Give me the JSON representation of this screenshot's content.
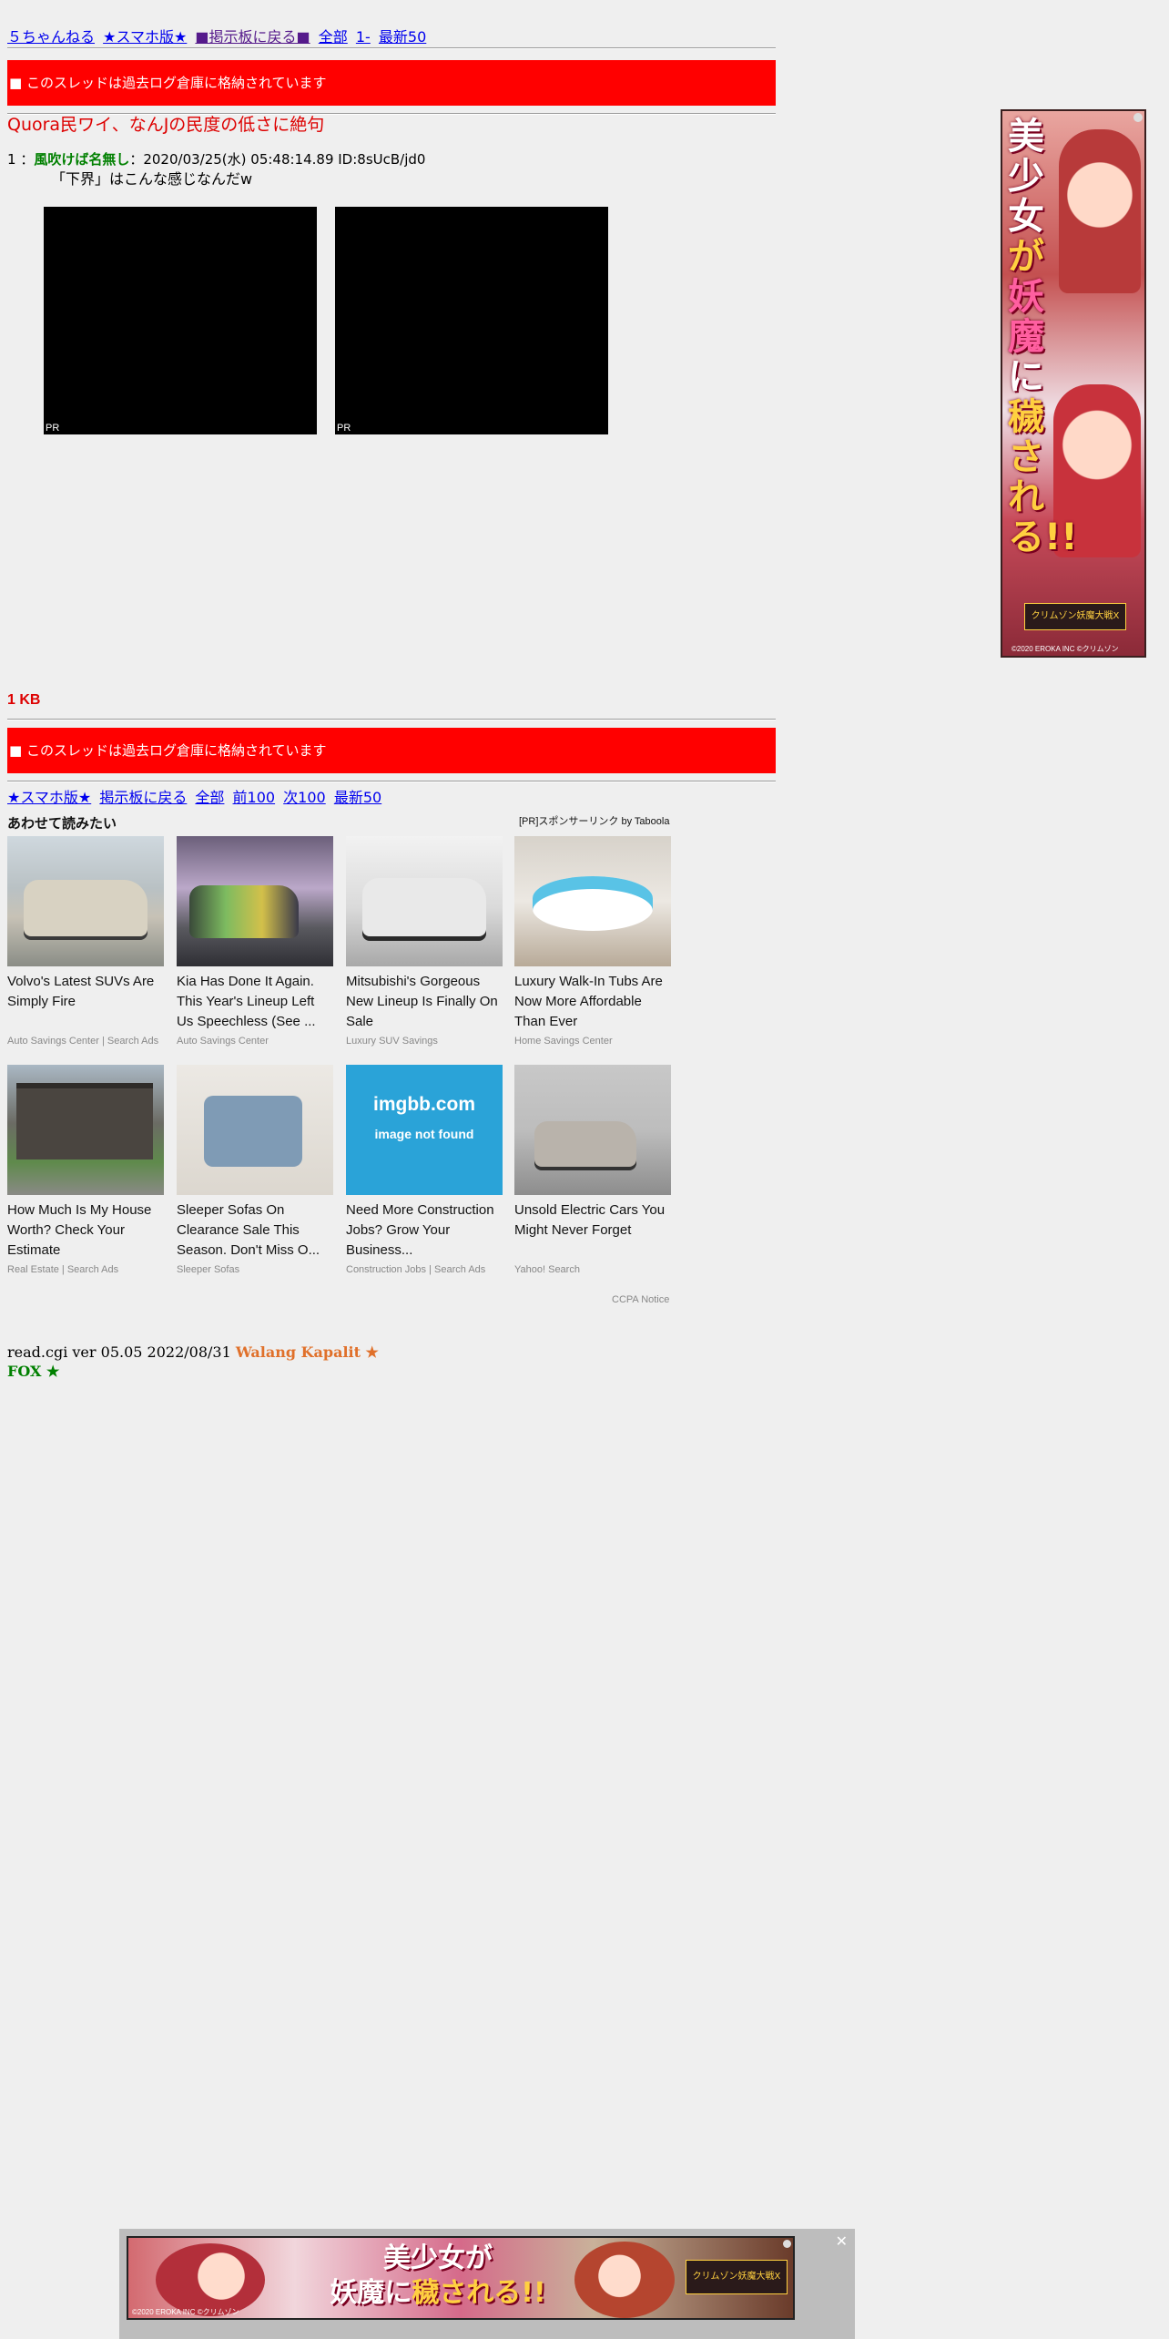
{
  "nav_top": {
    "site": "５ちゃんねる",
    "smartphone": "★スマホ版★",
    "back_board": "■掲示板に戻る■",
    "all": "全部",
    "first": "1-",
    "latest50": "最新50"
  },
  "archived_notice": "■ このスレッドは過去ログ倉庫に格納されています",
  "thread_title": "Quora民ワイ、なんJの民度の低さに絶句",
  "post": {
    "number": "1",
    "sep": " ：",
    "name": "風吹けば名無し",
    "meta": "：2020/03/25(水) 05:48:14.89 ID:8sUcB/jd0",
    "body": "「下界」はこんな感じなんだw"
  },
  "ad_pr_label": "PR",
  "size_label": "1 KB",
  "nav_bottom": {
    "smartphone": "★スマホ版★",
    "back_board": "掲示板に戻る",
    "all": "全部",
    "prev100": "前100",
    "next100": "次100",
    "latest50": "最新50"
  },
  "related": {
    "title": "あわせて読みたい",
    "sponsored": "[PR]スポンサーリンク by Taboola",
    "cards": [
      {
        "title": "Volvo's Latest SUVs Are Simply Fire",
        "source": "Auto Savings Center | Search Ads"
      },
      {
        "title": "Kia Has Done It Again. This Year's Lineup Left Us Speechless (See ...",
        "source": "Auto Savings Center"
      },
      {
        "title": "Mitsubishi's Gorgeous New Lineup Is Finally On Sale",
        "source": "Luxury SUV Savings"
      },
      {
        "title": "Luxury Walk-In Tubs Are Now More Affordable Than Ever",
        "source": "Home Savings Center"
      },
      {
        "title": "How Much Is My House Worth? Check Your Estimate",
        "source": "Real Estate | Search Ads"
      },
      {
        "title": "Sleeper Sofas On Clearance Sale This Season. Don't Miss O...",
        "source": "Sleeper Sofas"
      },
      {
        "title": "Need More Construction Jobs? Grow Your Business...",
        "source": "Construction Jobs | Search Ads"
      },
      {
        "title": "Unsold Electric Cars You Might Never Forget",
        "source": "Yahoo! Search"
      }
    ],
    "imgbb_main": "imgbb.com",
    "imgbb_sub": "image not found",
    "ccpa": "CCPA Notice"
  },
  "footer": {
    "version": "read.cgi ver 05.05 2022/08/31 ",
    "walang": "Walang Kapalit ★",
    "fox": "FOX ★"
  },
  "side_ad": {
    "line1": "美少女",
    "line2": "が",
    "line3": "妖魔",
    "line4": "に",
    "line5": "穢される!!",
    "logo": "クリムゾン妖魔大戦X",
    "copyright": "©2020 EROKA INC ©クリムゾン"
  },
  "bottom_ad": {
    "line1": "美少女が",
    "line2a": "妖魔",
    "line2b": "に",
    "line2c": "穢される!!",
    "logo": "クリムゾン妖魔大戦X",
    "copyright": "©2020 EROKA INC ©クリムゾン",
    "close": "✕"
  }
}
